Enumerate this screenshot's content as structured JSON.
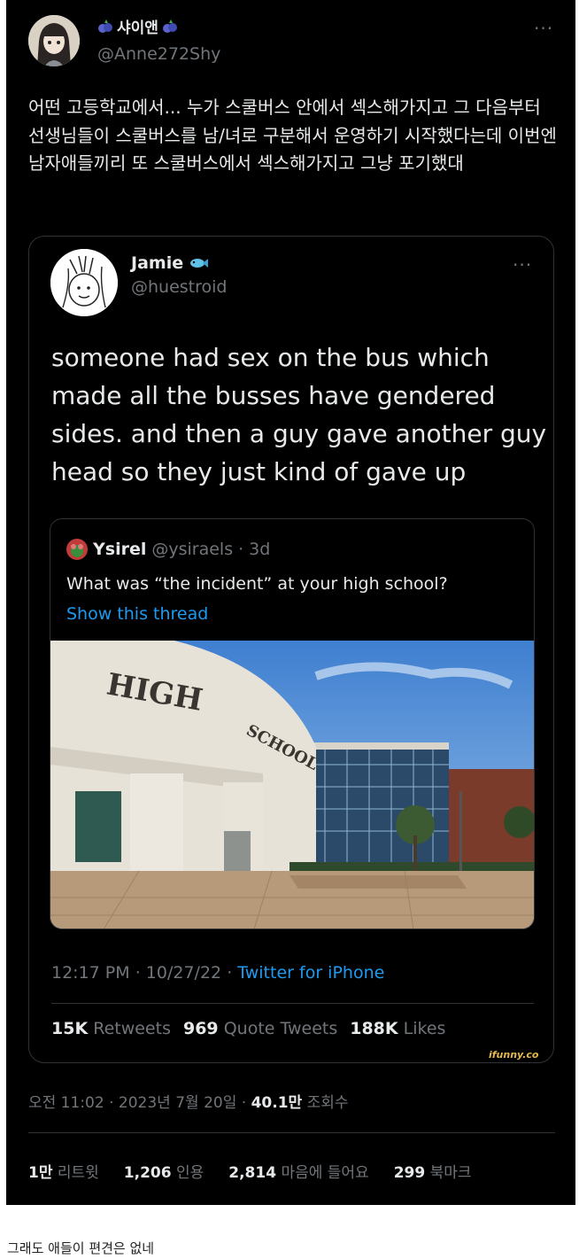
{
  "tweet": {
    "display_name": "샤이앤",
    "handle": "@Anne272Shy",
    "more": "···",
    "text": "어떤 고등학교에서... 누가 스쿨버스 안에서 섹스해가지고 그 다음부터 선생님들이 스쿨버스를 남/녀로 구분해서 운영하기 시작했다는데 이번엔 남자애들끼리 또 스쿨버스에서 섹스해가지고 그냥 포기했대",
    "meta": {
      "time": "오전 11:02",
      "date": "2023년 7월 20일",
      "views_count": "40.1만",
      "views_label": "조회수"
    },
    "stats": [
      {
        "count": "1만",
        "label": "리트윗"
      },
      {
        "count": "1,206",
        "label": "인용"
      },
      {
        "count": "2,814",
        "label": "마음에 들어요"
      },
      {
        "count": "299",
        "label": "북마크"
      }
    ]
  },
  "quoted": {
    "display_name": "Jamie",
    "handle": "@huestroid",
    "more": "···",
    "text": "someone had sex on the bus which made all the busses have gendered sides. and then a guy gave another guy head so they just kind of gave up",
    "inner": {
      "display_name": "Ysirel",
      "handle": "@ysiraels",
      "age": "3d",
      "text": "What was “the incident” at your high school?",
      "link": "Show this thread",
      "sign_word1": "HIGH",
      "sign_word2": "SCHOOL"
    },
    "time": "12:17 PM",
    "date": "10/27/22",
    "source": "Twitter for iPhone",
    "stats": [
      {
        "count": "15K",
        "label": "Retweets"
      },
      {
        "count": "969",
        "label": "Quote Tweets"
      },
      {
        "count": "188K",
        "label": "Likes"
      }
    ]
  },
  "watermark": "ifunny.co",
  "caption": "그래도 애들이 편견은 없네",
  "colors": {
    "background": "#000000",
    "text": "#e7e9ea",
    "muted": "#71767b",
    "link": "#1d9bf0",
    "border": "#2f3336"
  }
}
